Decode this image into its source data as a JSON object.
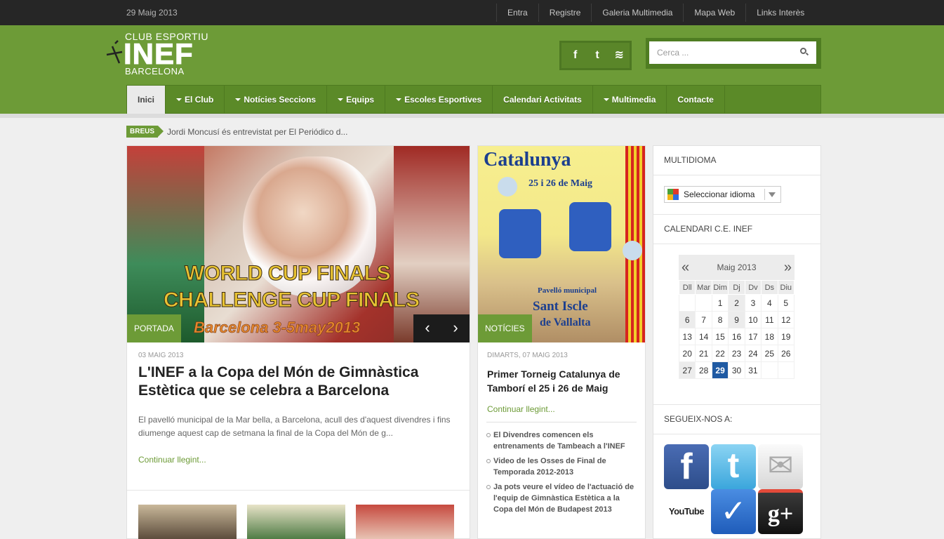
{
  "topbar": {
    "date": "29 Maig 2013",
    "links": [
      "Entra",
      "Registre",
      "Galeria Multimedia",
      "Mapa Web",
      "Links Interès"
    ]
  },
  "logo": {
    "line1": "CLUB ESPORTIU",
    "line2": "INEF",
    "line3": "BARCELONA"
  },
  "header_social": [
    {
      "icon": "facebook-icon",
      "glyph": "f"
    },
    {
      "icon": "twitter-icon",
      "glyph": "t"
    },
    {
      "icon": "rss-icon",
      "glyph": "≋"
    }
  ],
  "search": {
    "placeholder": "Cerca ..."
  },
  "nav": [
    {
      "label": "Inici",
      "dropdown": false,
      "active": true
    },
    {
      "label": "El Club",
      "dropdown": true
    },
    {
      "label": "Notícies Seccions",
      "dropdown": true
    },
    {
      "label": "Equips",
      "dropdown": true
    },
    {
      "label": "Escoles Esportives",
      "dropdown": true
    },
    {
      "label": "Calendari Activitats",
      "dropdown": false
    },
    {
      "label": "Multimedia",
      "dropdown": true
    },
    {
      "label": "Contacte",
      "dropdown": false
    }
  ],
  "breus": {
    "tag": "BREUS",
    "text": "Jordi Moncusí és entrevistat per El Periódico d..."
  },
  "featured": {
    "image_text": {
      "line1": "WORLD CUP FINALS",
      "line2": "CHALLENGE CUP FINALS",
      "line3": "Barcelona 3-5may2013"
    },
    "category": "PORTADA",
    "date": "03 MAIG 2013",
    "title": "L'INEF a la Copa del Món de Gimnàstica Estètica que se celebra a Barcelona",
    "excerpt": "El pavelló municipal de la Mar bella, a Barcelona, acull des d'aquest divendres i fins diumenge aquest cap de setmana la final de la Copa del Món de g...",
    "more": "Continuar llegint..."
  },
  "news": {
    "image_text": {
      "title": "Catalunya",
      "dates": "25 i 26 de Maig",
      "venue1": "Pavelló municipal",
      "venue2": "Sant Iscle",
      "venue3": "de Vallalta"
    },
    "category": "NOTÍCIES",
    "date": "DIMARTS, 07 MAIG 2013",
    "title": "Primer Torneig Catalunya de Tamborí el 25 i 26 de Maig",
    "more": "Continuar llegint...",
    "list": [
      "El Divendres comencen els entrenaments de Tambeach a l'INEF",
      "Video de les Osses de Final de Temporada 2012-2013",
      "Ja pots veure el vídeo de l'actuació de l'equip de Gimnàstica Estètica a la Copa del Món de Budapest 2013"
    ]
  },
  "sidebar": {
    "multiidioma": "MULTIDIOMA",
    "language_select": "Seleccionar idioma",
    "calendar_title": "CALENDARI C.E. INEF",
    "calendar": {
      "month": "Maig 2013",
      "prev": "«",
      "next": "»",
      "days": [
        "Dll",
        "Mar",
        "Dim",
        "Dj",
        "Dv",
        "Ds",
        "Diu"
      ],
      "weeks": [
        [
          "",
          "",
          "1",
          "2",
          "3",
          "4",
          "5"
        ],
        [
          "6",
          "7",
          "8",
          "9",
          "10",
          "11",
          "12"
        ],
        [
          "13",
          "14",
          "15",
          "16",
          "17",
          "18",
          "19"
        ],
        [
          "20",
          "21",
          "22",
          "23",
          "24",
          "25",
          "26"
        ],
        [
          "27",
          "28",
          "29",
          "30",
          "31",
          "",
          ""
        ]
      ],
      "today": "29",
      "event_days": [
        "2",
        "6",
        "9",
        "27"
      ]
    },
    "follow_title": "SEGUEIX-NOS A:",
    "follow_icons": [
      {
        "name": "facebook-icon",
        "glyph": "f",
        "color": "#3b5998"
      },
      {
        "name": "twitter-icon",
        "glyph": "t",
        "color": "#4fb4e5"
      },
      {
        "name": "email-rss-icon",
        "glyph": "✉",
        "color": "#dddddd"
      },
      {
        "name": "youtube-icon",
        "glyph": "YouTube",
        "color": "#ffffff"
      },
      {
        "name": "foursquare-icon",
        "glyph": "✓",
        "color": "#2c6fcf"
      },
      {
        "name": "google-plus-icon",
        "glyph": "g+",
        "color": "#222222"
      }
    ]
  },
  "colors": {
    "brand_green": "#6d9b37",
    "topbar": "#262626",
    "today": "#1f5aa3"
  }
}
